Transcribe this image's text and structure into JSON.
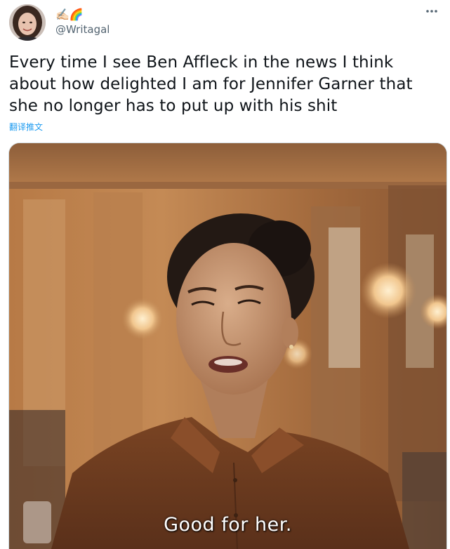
{
  "tweet": {
    "author": {
      "display_emojis": "✍🏻🌈",
      "handle": "@Writagal",
      "avatar_icon": "profile-photo-icon"
    },
    "more_icon": "more-options-icon",
    "text": "Every time I see Ben Affleck in the news I think about how delighted I am for Jennifer Garner that she no longer has to put up with his shit",
    "translate_label": "翻译推文",
    "media": {
      "type": "gif",
      "subtitle": "Good for her."
    }
  },
  "colors": {
    "link_blue": "#1d9bf0",
    "secondary_text": "#536471",
    "primary_text": "#0f1419",
    "border": "#cfd9de"
  }
}
